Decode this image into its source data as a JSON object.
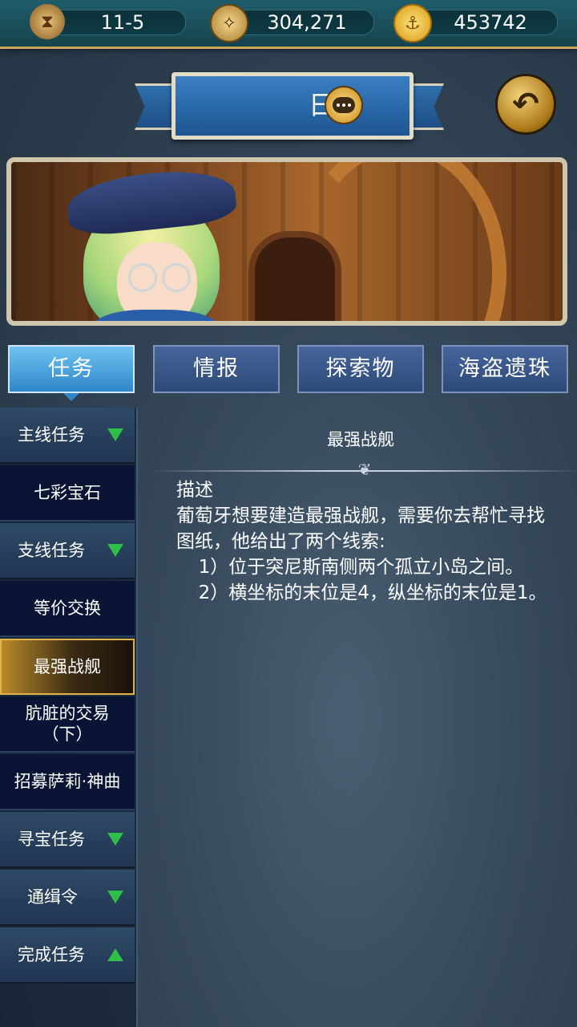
{
  "resources": {
    "stage": "11-5",
    "compass_value": "304,271",
    "gold_value": "453742"
  },
  "header": {
    "title": "日志"
  },
  "tabs": [
    {
      "label": "任务",
      "active": true
    },
    {
      "label": "情报",
      "active": false
    },
    {
      "label": "探索物",
      "active": false
    },
    {
      "label": "海盗遗珠",
      "active": false
    }
  ],
  "sidebar": {
    "items": [
      {
        "label": "主线任务",
        "type": "category",
        "arrow": "down"
      },
      {
        "label": "七彩宝石",
        "type": "quest"
      },
      {
        "label": "支线任务",
        "type": "category",
        "arrow": "down"
      },
      {
        "label": "等价交换",
        "type": "quest"
      },
      {
        "label": "最强战舰",
        "type": "quest",
        "selected": true
      },
      {
        "label": "肮脏的交易（下）",
        "type": "quest"
      },
      {
        "label": "招募萨莉·神曲",
        "type": "quest"
      },
      {
        "label": "寻宝任务",
        "type": "category",
        "arrow": "down"
      },
      {
        "label": "通缉令",
        "type": "category",
        "arrow": "down"
      },
      {
        "label": "完成任务",
        "type": "category",
        "arrow": "up"
      }
    ]
  },
  "detail": {
    "title": "最强战舰",
    "heading": "描述",
    "intro": "葡萄牙想要建造最强战舰，需要你去帮忙寻找图纸，他给出了两个线索:",
    "clue1": "1）位于突尼斯南侧两个孤立小岛之间。",
    "clue2": "2）横坐标的末位是4，纵坐标的末位是1。"
  },
  "icons": {
    "stage": "hourglass-icon",
    "compass": "compass-icon",
    "gold": "anchor-coin-icon",
    "chat": "chat-bubble-icon",
    "back": "back-arrow-icon"
  },
  "colors": {
    "tab_active": "#2f86c8",
    "tab_inactive": "#2d4a78",
    "arrow_green": "#2fbf4a",
    "selected_gold": "#e0b44a"
  }
}
